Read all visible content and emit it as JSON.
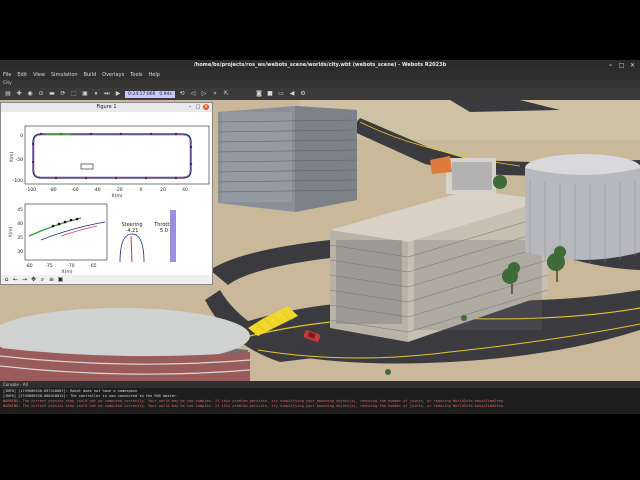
{
  "window": {
    "title": "/home/bs/projects/ros_ws/webots_scene/worlds/city.wbt (webots_scene) - Webots R2023b"
  },
  "menu": [
    "File",
    "Edit",
    "View",
    "Simulation",
    "Build",
    "Overlays",
    "Tools",
    "Help"
  ],
  "tab": "City",
  "toolbar": {
    "time": "0:24:17:066",
    "speed": "0.94x"
  },
  "figure": {
    "title": "Figure 1",
    "plot1": {
      "ylabel": "Y(m)",
      "xlabel": "X(m)",
      "xticks": [
        "-100",
        "-80",
        "-60",
        "-40",
        "-20",
        "0",
        "20",
        "40"
      ],
      "yticks": [
        "0",
        "-50",
        "-100"
      ]
    },
    "plot2": {
      "ylabel": "Y(m)",
      "xlabel": "X(m)",
      "xticks": [
        "-80",
        "-75",
        "-70",
        "-65"
      ],
      "yticks": [
        "45",
        "40",
        "35",
        "30"
      ]
    },
    "steering_label": "Steering",
    "steering_value": "-4.21",
    "throttle_label": "Throttle",
    "throttle_value": "5.0"
  },
  "console": {
    "header": "Console - All",
    "lines": [
      {
        "type": "info",
        "text": "[INFO] [1749609530.057418087]: Robot does not have a namespace"
      },
      {
        "type": "info",
        "text": "[INFO] [1749609530.060418014]: The controller is now connected to the ROS master."
      },
      {
        "type": "warn",
        "text": "WARNING: The current physics step could not be computed correctly. Your world may be too complex. If this problem persists, try simplifying your bounding object(s), reducing the number of joints, or reducing WorldInfo.basicTimeStep."
      },
      {
        "type": "warn",
        "text": "WARNING: The current physics step could not be computed correctly. Your world may be too complex. If this problem persists, try simplifying your bounding object(s), reducing the number of joints, or reducing WorldInfo.basicTimeStep."
      }
    ]
  },
  "colors": {
    "accent": "#e95420",
    "road": "#3a3a3f",
    "ground": "#c9b99a",
    "time_bg": "#c8c8ff"
  }
}
